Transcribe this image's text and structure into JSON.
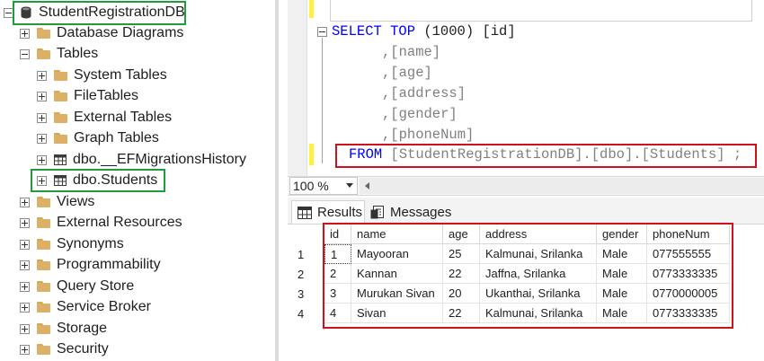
{
  "object_explorer": {
    "items": [
      {
        "label": "StudentRegistrationDB",
        "icon": "database-icon",
        "expander": "minus",
        "highlighted": true
      },
      {
        "label": "Database Diagrams",
        "icon": "folder-icon",
        "expander": "plus"
      },
      {
        "label": "Tables",
        "icon": "folder-icon",
        "expander": "minus"
      },
      {
        "label": "System Tables",
        "icon": "folder-icon",
        "expander": "plus"
      },
      {
        "label": "FileTables",
        "icon": "folder-icon",
        "expander": "plus"
      },
      {
        "label": "External Tables",
        "icon": "folder-icon",
        "expander": "plus"
      },
      {
        "label": "Graph Tables",
        "icon": "folder-icon",
        "expander": "plus"
      },
      {
        "label": "dbo.__EFMigrationsHistory",
        "icon": "table-icon",
        "expander": "plus"
      },
      {
        "label": "dbo.Students",
        "icon": "table-icon",
        "expander": "plus",
        "highlighted": true
      },
      {
        "label": "Views",
        "icon": "folder-icon",
        "expander": "plus"
      },
      {
        "label": "External Resources",
        "icon": "folder-icon",
        "expander": "plus"
      },
      {
        "label": "Synonyms",
        "icon": "folder-icon",
        "expander": "plus"
      },
      {
        "label": "Programmability",
        "icon": "folder-icon",
        "expander": "plus"
      },
      {
        "label": "Query Store",
        "icon": "folder-icon",
        "expander": "plus"
      },
      {
        "label": "Service Broker",
        "icon": "folder-icon",
        "expander": "plus"
      },
      {
        "label": "Storage",
        "icon": "folder-icon",
        "expander": "plus"
      },
      {
        "label": "Security",
        "icon": "folder-icon",
        "expander": "plus"
      }
    ]
  },
  "editor": {
    "line1": {
      "kw1": "SELECT",
      "kw2": "TOP",
      "rest": " (1000) [id]"
    },
    "columns": [
      ",[name]",
      ",[age]",
      ",[address]",
      ",[gender]",
      ",[phoneNum]"
    ],
    "from_line": {
      "kw": "FROM",
      "rest": " [StudentRegistrationDB].[dbo].[Students] ;"
    }
  },
  "zoom": {
    "value": "100 %"
  },
  "tabs": {
    "results": "Results",
    "messages": "Messages"
  },
  "results": {
    "columns": [
      "id",
      "name",
      "age",
      "address",
      "gender",
      "phoneNum"
    ],
    "rownums": [
      "1",
      "2",
      "3",
      "4"
    ],
    "rows": [
      [
        "1",
        "Mayooran",
        "25",
        "Kalmunai, Srilanka",
        "Male",
        "077555555"
      ],
      [
        "2",
        "Kannan",
        "22",
        "Jaffna, Srilanka",
        "Male",
        "0773333335"
      ],
      [
        "3",
        "Murukan Sivan",
        "20",
        "Ukanthai, Srilanka",
        "Male",
        "0770000005"
      ],
      [
        "4",
        "Sivan",
        "22",
        "Kalmunai, Srilanka",
        "Male",
        "0773333335"
      ]
    ]
  },
  "colors": {
    "highlight_green": "#1f9c3c",
    "highlight_red": "#d0101b",
    "keyword_blue": "#0000ff"
  }
}
